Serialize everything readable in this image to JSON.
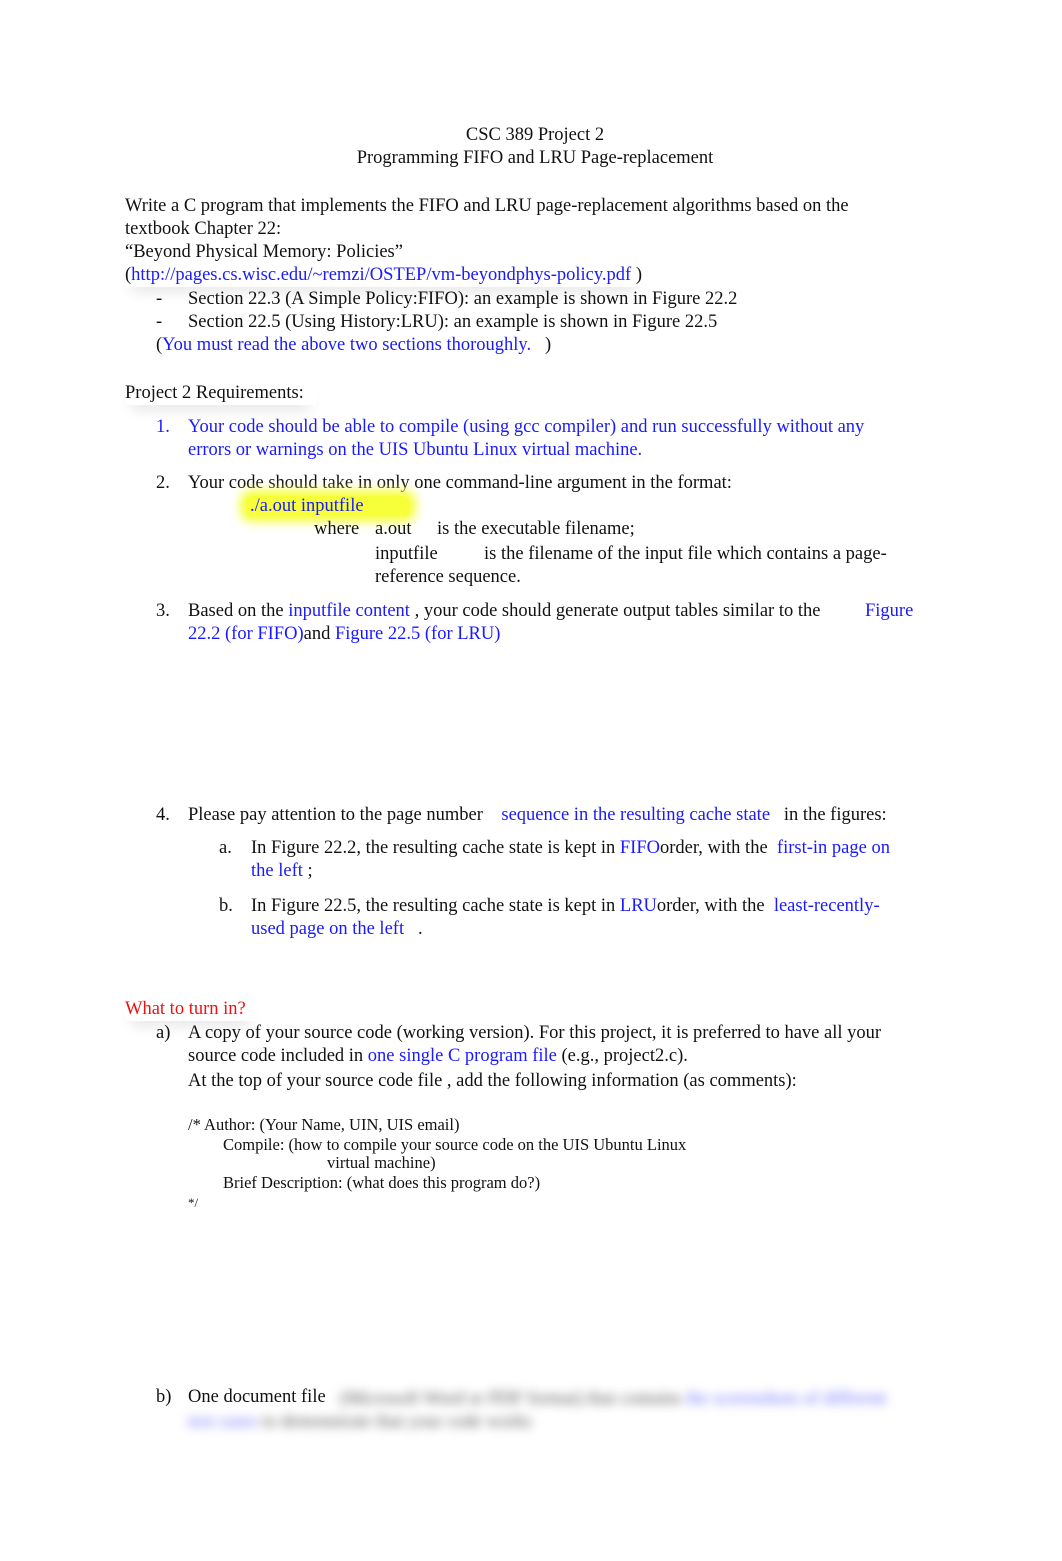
{
  "title": {
    "line1": "CSC 389 Project 2",
    "line2": "Programming FIFO and LRU Page-replacement"
  },
  "intro": {
    "line1": "Write a C program that implements the FIFO and LRU page-replacement algorithms based on the",
    "line2": "textbook Chapter 22:",
    "chapter_title": "“Beyond Physical Memory: Policies”",
    "link_open": "(",
    "link": "http://pages.cs.wisc.edu/~remzi/OSTEP/vm-beyondphys-policy.pdf",
    "link_close": ")",
    "bullets": [
      {
        "marker": "-",
        "pre": "Section 22.3 (A Simple Policy:",
        "policy": "FIFO",
        "post": "): an example is shown in Figure 22.2"
      },
      {
        "marker": "-",
        "pre": "Section 22.5 (Using History:",
        "policy": "LRU",
        "post": "): an example is shown in Figure 22.5"
      }
    ],
    "note_open": "(",
    "note": "You must read the above two sections thoroughly.",
    "note_close": ")"
  },
  "requirements": {
    "heading": "Project 2 Requirements:",
    "r1": {
      "num": "1.",
      "line1": "Your code should be able to compile (using gcc compiler) and run successfully without any",
      "line2": "errors or warnings on the UIS Ubuntu Linux virtual machine."
    },
    "r2": {
      "num": "2.",
      "line1": "Your code should take in only one command-line argument in the format:",
      "command": "./a.out inputfile",
      "where": "where",
      "aout_term": "a.out",
      "aout_desc": "is the executable filename;",
      "input_term": "inputfile",
      "input_desc": "is the filename of the input file which contains a page-",
      "input_desc2": "reference sequence."
    },
    "r3": {
      "num": "3.",
      "pre": "Based on the",
      "link1": "inputfile content",
      "mid": ", your code should generate output tables similar to the",
      "fig_a1": "Figure",
      "fig_a2": "22.2 (for FIFO)",
      "and": "and",
      "fig_b": "Figure 22.5 (for LRU)"
    },
    "r4": {
      "num": "4.",
      "pre": "Please pay attention to the page number",
      "link": "sequence in the resulting cache state",
      "post": "in the figures:",
      "a": {
        "marker": "a.",
        "pre": "In Figure 22.2, the resulting cache state is kept in",
        "order": "FIFO",
        "mid": "order, with the",
        "link1": "first-in page on",
        "link2": "the left",
        "post": ";"
      },
      "b": {
        "marker": "b.",
        "pre": "In Figure 22.5, the resulting cache state is kept in",
        "order": "LRU",
        "mid": "order, with the",
        "link1": "least-recently-",
        "link2": "used page on the left",
        "post": "."
      }
    }
  },
  "turn_in": {
    "heading": "What to turn in?",
    "a": {
      "marker": "a)",
      "line1": "A copy of your source code (working version). For this project, it is preferred to have all your",
      "line2_pre": "source code included in",
      "line2_link": "one single C program file",
      "line2_post": "(e.g., project2.c).",
      "line3_pre": "At the top of your source code file",
      "line3_post": ", add the following information (as comments):",
      "comment": {
        "l1": "/* Author: (Your Name, UIN, UIS email)",
        "l2": "Compile: (how to compile your source code on the UIS Ubuntu Linux",
        "l3": "virtual machine)",
        "l4": "Brief Description: (what does this program do?)",
        "l5": "*/"
      }
    },
    "b": {
      "marker": "b)",
      "label": "One document file",
      "blurred": "(Microsoft Word or PDF format) that contains",
      "blurred_link": "the screenshots of different",
      "blurred_link2": "test cases",
      "blurred2": "to demonstrate that your code works"
    }
  }
}
